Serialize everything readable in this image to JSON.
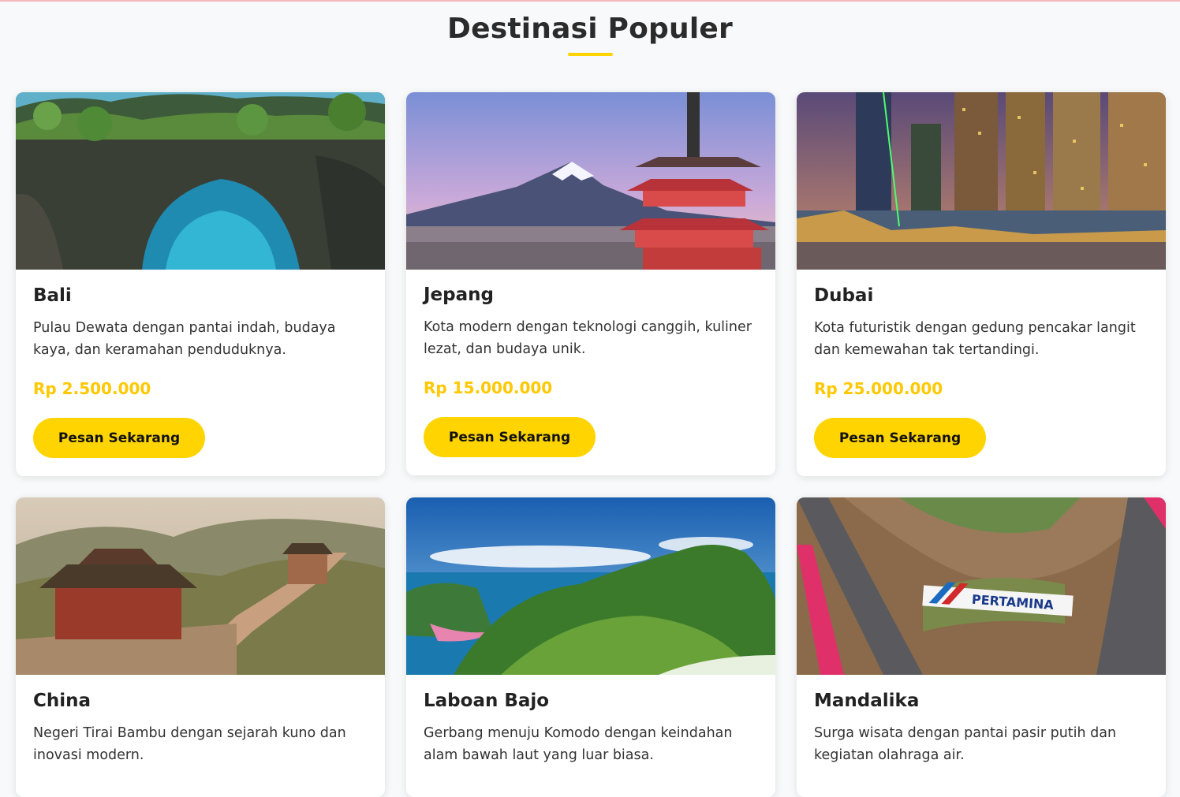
{
  "section": {
    "title": "Destinasi Populer"
  },
  "colors": {
    "accent": "#ffd400",
    "price": "#ffc800",
    "background": "#f8f9fa"
  },
  "destinations": [
    {
      "name": "Bali",
      "description": "Pulau Dewata dengan pantai indah, budaya kaya, dan keramahan penduduknya.",
      "price": "Rp 2.500.000",
      "button_label": "Pesan Sekarang",
      "image_icon": "sea-arch-photo"
    },
    {
      "name": "Jepang",
      "description": "Kota modern dengan teknologi canggih, kuliner lezat, dan budaya unik.",
      "price": "Rp 15.000.000",
      "button_label": "Pesan Sekarang",
      "image_icon": "mount-fuji-pagoda-photo"
    },
    {
      "name": "Dubai",
      "description": "Kota futuristik dengan gedung pencakar langit dan kemewahan tak tertandingi.",
      "price": "Rp 25.000.000",
      "button_label": "Pesan Sekarang",
      "image_icon": "city-skyline-night-photo"
    },
    {
      "name": "China",
      "description": "Negeri Tirai Bambu dengan sejarah kuno dan inovasi modern.",
      "image_icon": "great-wall-photo"
    },
    {
      "name": "Laboan Bajo",
      "description": "Gerbang menuju Komodo dengan keindahan alam bawah laut yang luar biasa.",
      "image_icon": "island-hills-bay-photo"
    },
    {
      "name": "Mandalika",
      "description": "Surga wisata dengan pantai pasir putih dan kegiatan olahraga air.",
      "image_icon": "race-circuit-aerial-photo",
      "image_text": "PERTAMINA"
    }
  ]
}
